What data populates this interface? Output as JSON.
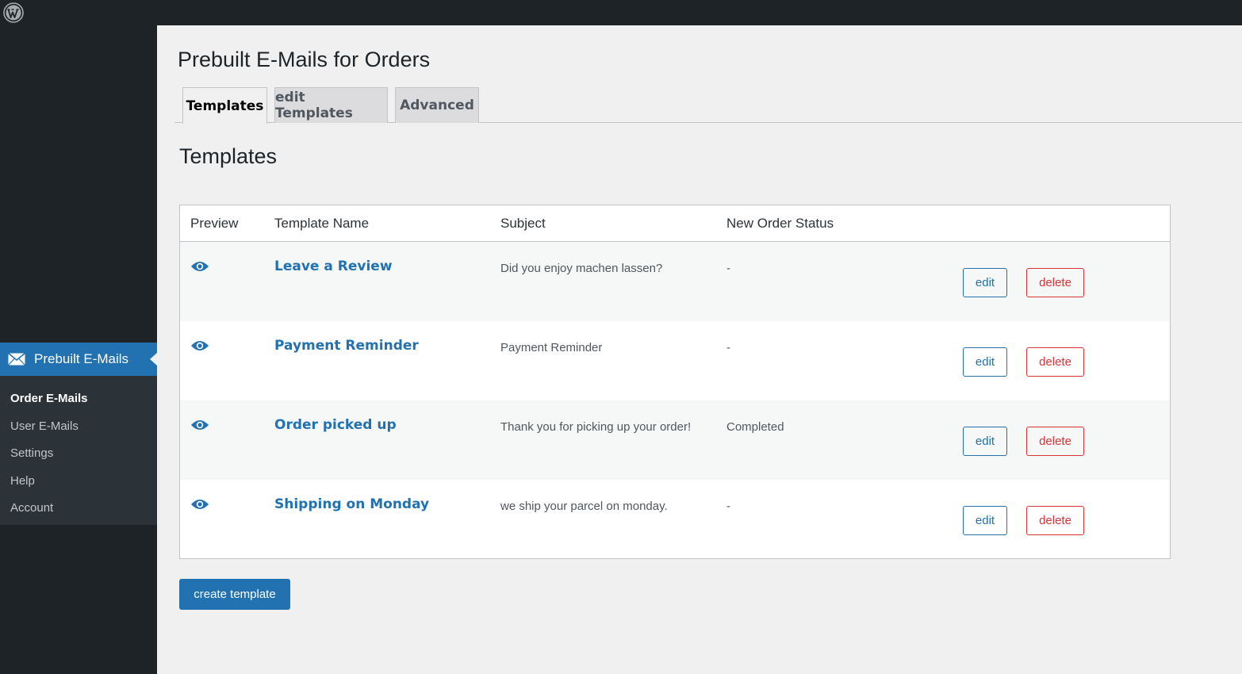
{
  "sidebar": {
    "menu_label": "Prebuilt E-Mails",
    "items": [
      {
        "label": "Order E-Mails"
      },
      {
        "label": "User E-Mails"
      },
      {
        "label": "Settings"
      },
      {
        "label": "Help"
      },
      {
        "label": "Account"
      }
    ],
    "current_index": 0
  },
  "page": {
    "title": "Prebuilt E-Mails for Orders",
    "section_title": "Templates"
  },
  "tabs": [
    {
      "label": "Templates",
      "active": true
    },
    {
      "label": "edit Templates",
      "active": false
    },
    {
      "label": "Advanced",
      "active": false
    }
  ],
  "table": {
    "headers": {
      "preview": "Preview",
      "name": "Template Name",
      "subject": "Subject",
      "status": "New Order Status"
    },
    "rows": [
      {
        "name": "Leave a Review",
        "subject": "Did you enjoy machen lassen?",
        "status": "-",
        "edit": "edit",
        "delete": "delete"
      },
      {
        "name": "Payment Reminder",
        "subject": "Payment Reminder",
        "status": "-",
        "edit": "edit",
        "delete": "delete"
      },
      {
        "name": "Order picked up",
        "subject": "Thank you for picking up your order!",
        "status": "Completed",
        "edit": "edit",
        "delete": "delete"
      },
      {
        "name": "Shipping on Monday",
        "subject": "we ship your parcel on monday.",
        "status": "-",
        "edit": "edit",
        "delete": "delete"
      }
    ]
  },
  "actions": {
    "create_label": "create template"
  },
  "icons": {
    "logo": "wordpress-icon",
    "menu": "envelope-icon",
    "preview": "eye-icon"
  },
  "colors": {
    "accent": "#2271b1",
    "danger": "#d63638",
    "sidebar_bg": "#1d2327",
    "submenu_bg": "#2c3338"
  }
}
